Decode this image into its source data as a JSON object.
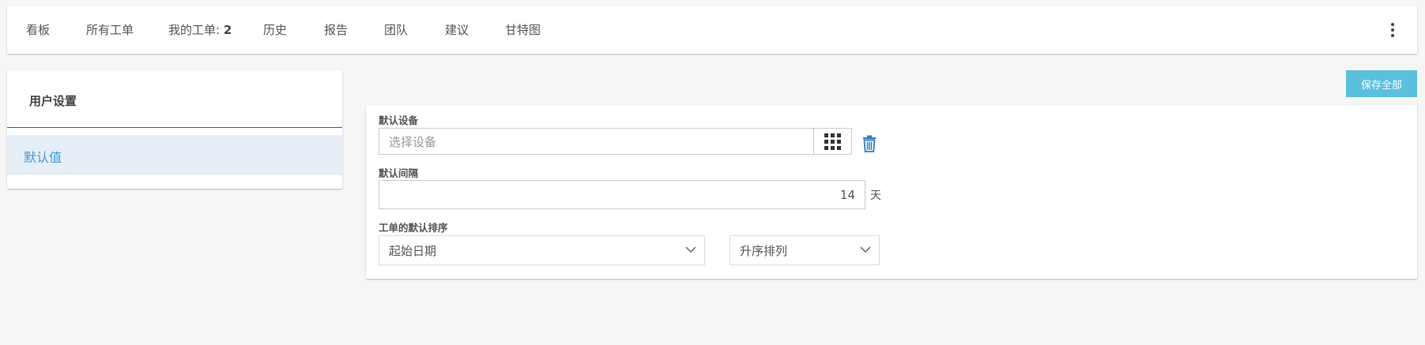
{
  "nav": {
    "tabs": [
      {
        "label": "看板"
      },
      {
        "label": "所有工单"
      },
      {
        "label": "我的工单: ",
        "count": "2"
      },
      {
        "label": "历史"
      },
      {
        "label": "报告"
      },
      {
        "label": "团队"
      },
      {
        "label": "建议"
      },
      {
        "label": "甘特图"
      }
    ],
    "more_icon": "vertical-dots-icon"
  },
  "sidebar": {
    "title": "用户设置",
    "items": [
      {
        "label": "默认值",
        "active": true
      }
    ]
  },
  "toolbar": {
    "save_label": "保存全部"
  },
  "form": {
    "default_device": {
      "label": "默认设备",
      "placeholder": "选择设备",
      "value": "",
      "grid_icon": "grid-icon",
      "delete_icon": "trash-icon"
    },
    "default_interval": {
      "label": "默认间隔",
      "value": "14",
      "unit": "天"
    },
    "default_sort": {
      "label": "工单的默认排序",
      "field_value": "起始日期",
      "order_value": "升序排列"
    }
  },
  "colors": {
    "accent": "#5bc0de",
    "active_item_bg": "#e6eff7",
    "active_item_text": "#3a9bd9",
    "trash_icon": "#2f7cc0"
  }
}
